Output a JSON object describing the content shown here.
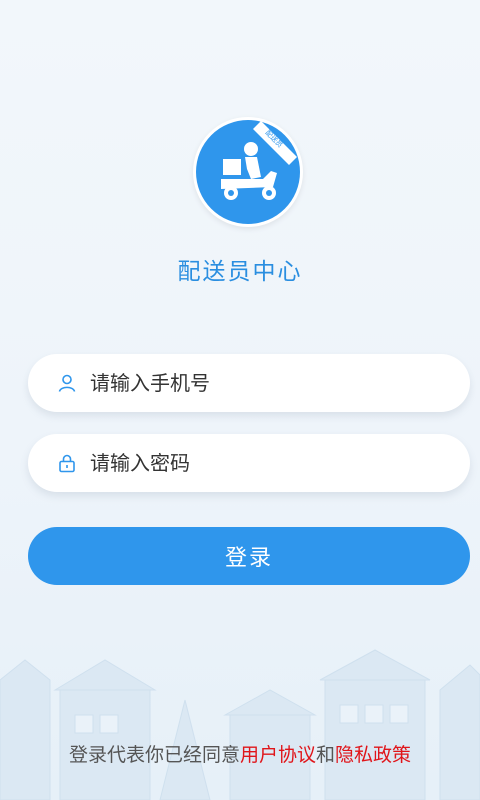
{
  "header": {
    "title": "配送员中心",
    "logo_badge": "配送员",
    "logo_color": "#2f96ec"
  },
  "form": {
    "phone_placeholder": "请输入手机号",
    "password_placeholder": "请输入密码",
    "phone_icon": "user-icon",
    "password_icon": "lock-icon"
  },
  "login_button": {
    "label": "登录",
    "color": "#2f96ec"
  },
  "agreement": {
    "prefix": "登录代表你已经同意",
    "user_agreement": "用户协议",
    "connector": "和",
    "privacy_policy": "隐私政策",
    "link_color": "#e0151a"
  }
}
